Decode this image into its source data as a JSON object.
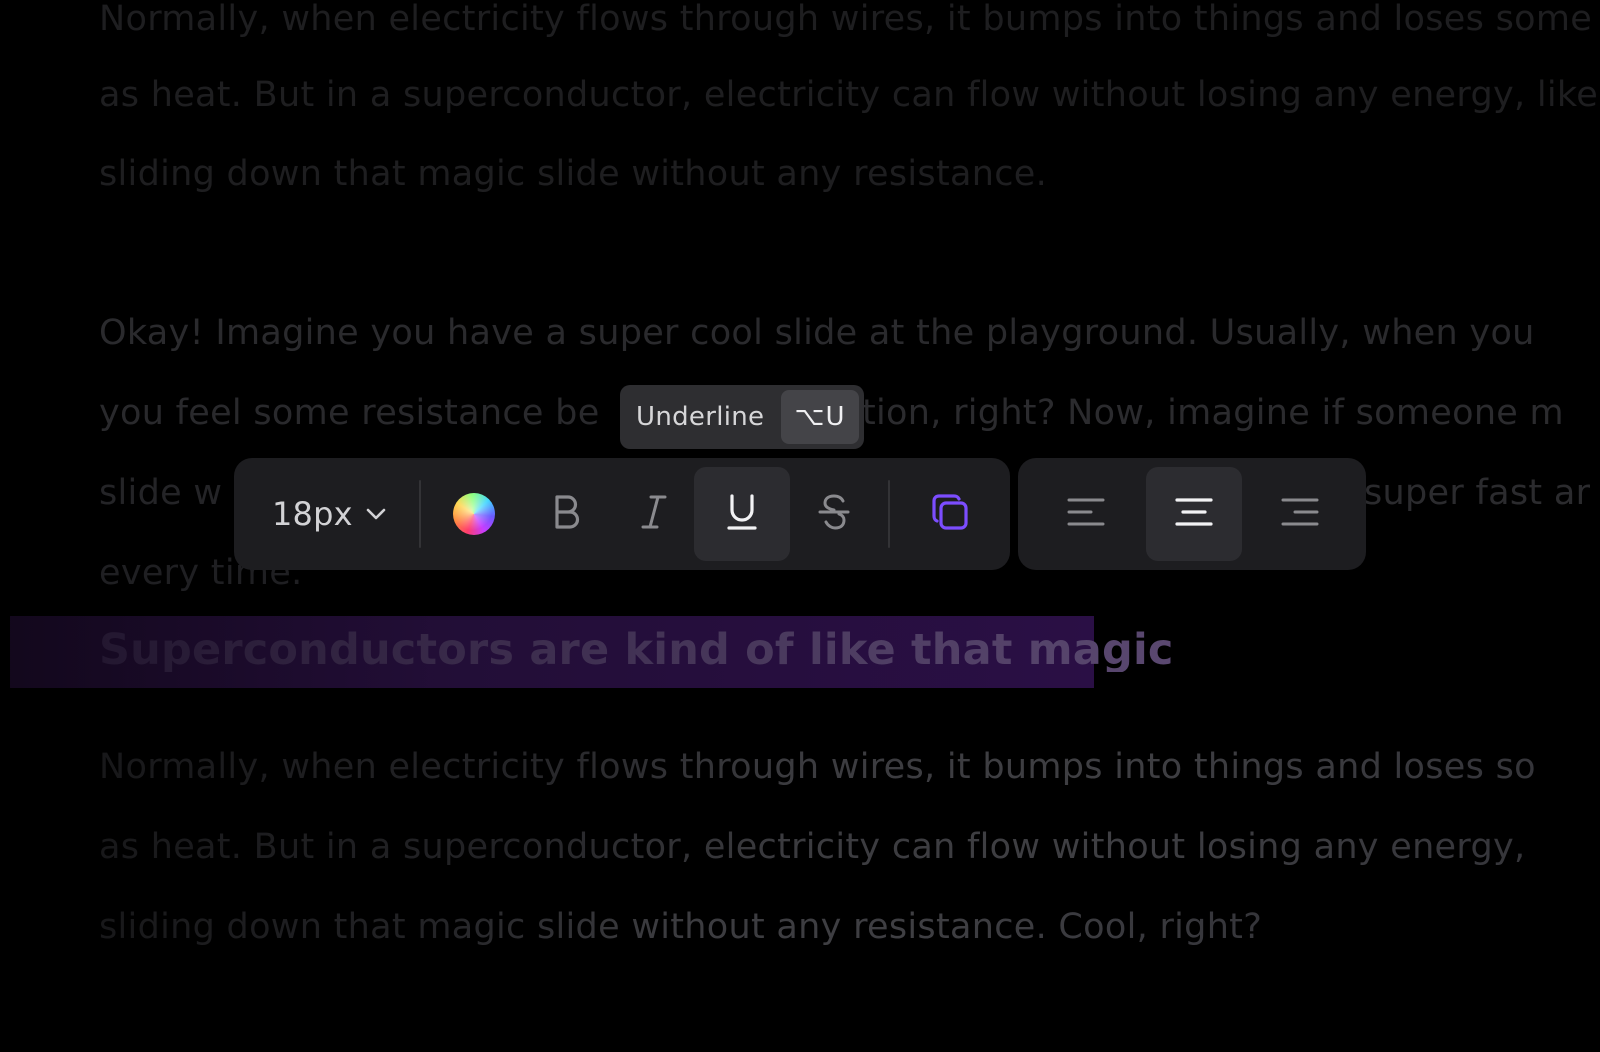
{
  "document": {
    "lines_top": [
      "Normally, when electricity flows through wires, it bumps into things and loses some energy",
      "as heat. But in a superconductor, electricity can flow without losing any energy, like",
      "sliding down that magic slide without any resistance."
    ],
    "paragraph_2": [
      "Okay! Imagine you have a super cool slide at the playground. Usually, when you",
      "you feel some resistance be",
      "tion, right? Now, imagine if someone m",
      "slide w",
      "super fast ar",
      "every time."
    ],
    "heading": "Superconductors are kind of like that magic",
    "lines_bottom": [
      "Normally, when electricity flows through wires, it bumps into things and loses so",
      "as heat. But in a superconductor, electricity can flow without losing any energy,",
      "sliding down that magic slide without any resistance. Cool, right?"
    ]
  },
  "tooltip": {
    "label": "Underline",
    "shortcut": "⌥U"
  },
  "toolbar": {
    "font_size": "18px",
    "items": [
      {
        "name": "font-size-select",
        "icon": "chevron-down-icon"
      },
      {
        "name": "text-color",
        "icon": "color-wheel-icon"
      },
      {
        "name": "bold",
        "icon": "bold-icon"
      },
      {
        "name": "italic",
        "icon": "italic-icon"
      },
      {
        "name": "underline",
        "icon": "underline-icon",
        "active": true
      },
      {
        "name": "strikethrough",
        "icon": "strikethrough-icon"
      },
      {
        "name": "copy-style",
        "icon": "copy-icon"
      }
    ],
    "alignment": [
      {
        "name": "align-left",
        "icon": "align-left-icon"
      },
      {
        "name": "align-center",
        "icon": "align-center-icon",
        "active": true
      },
      {
        "name": "align-right",
        "icon": "align-right-icon"
      }
    ]
  },
  "colors": {
    "background": "#000000",
    "toolbar": "#1d1d20",
    "active": "#2c2c30",
    "accent": "#7c4dff",
    "highlight": "#2a0f45"
  }
}
